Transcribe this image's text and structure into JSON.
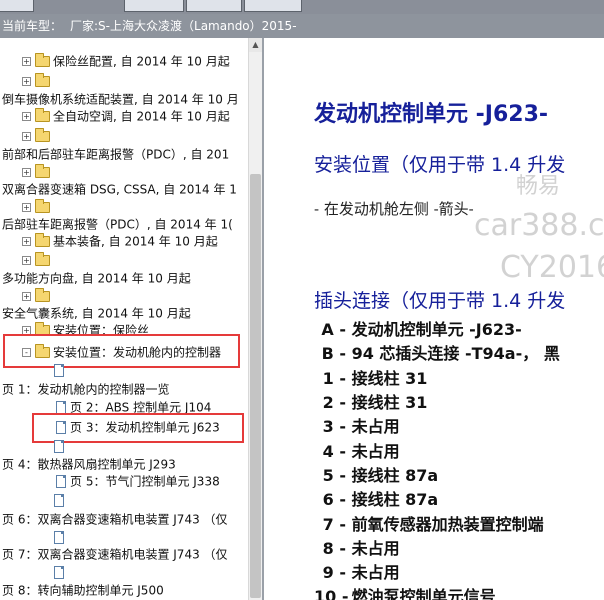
{
  "titlebar": {
    "label": "当前车型：",
    "model": "厂家:S-上海大众凌渡（Lamando）2015-"
  },
  "tree": [
    {
      "text": "保险丝配置, 自 2014 年 10 月起",
      "kind": "folder",
      "exp": "+"
    },
    {
      "text": "",
      "kind": "expander",
      "exp": "+"
    },
    {
      "text": "倒车摄像机系统适配装置, 自 2014 年 10 月",
      "kind": "text"
    },
    {
      "text": "全自动空调, 自 2014 年 10 月起",
      "kind": "folder",
      "exp": "+"
    },
    {
      "text": "",
      "kind": "expander",
      "exp": "+"
    },
    {
      "text": "前部和后部驻车距离报警（PDC）, 自 201",
      "kind": "text"
    },
    {
      "text": "",
      "kind": "expander",
      "exp": "+"
    },
    {
      "text": "双离合器变速箱 DSG, CSSA, 自 2014 年 1",
      "kind": "text"
    },
    {
      "text": "",
      "kind": "expander",
      "exp": "+"
    },
    {
      "text": "后部驻车距离报警（PDC）, 自 2014 年 1(",
      "kind": "text"
    },
    {
      "text": "基本装备, 自 2014 年 10 月起",
      "kind": "folder",
      "exp": "+"
    },
    {
      "text": "",
      "kind": "expander",
      "exp": "+"
    },
    {
      "text": "多功能方向盘, 自 2014 年 10 月起",
      "kind": "text"
    },
    {
      "text": "",
      "kind": "expander",
      "exp": "+"
    },
    {
      "text": "安全气囊系统, 自 2014 年 10 月起",
      "kind": "text"
    },
    {
      "text": "安装位置：保险丝",
      "kind": "folder",
      "exp": "+"
    },
    {
      "text": "安装位置：发动机舱内的控制器",
      "kind": "folder",
      "exp": "-"
    },
    {
      "text": "",
      "kind": "doc"
    },
    {
      "text": "页 1：发动机舱内的控制器一览",
      "kind": "text"
    },
    {
      "text": "页 2：ABS 控制单元 J104",
      "kind": "doc"
    },
    {
      "text": "页 3：发动机控制单元 J623",
      "kind": "doc"
    },
    {
      "text": "",
      "kind": "doc"
    },
    {
      "text": "页 4：散热器风扇控制单元 J293",
      "kind": "text"
    },
    {
      "text": "页 5：节气门控制单元 J338",
      "kind": "doc"
    },
    {
      "text": "",
      "kind": "doc"
    },
    {
      "text": "页 6：双离合器变速箱机电装置 J743 （仅",
      "kind": "text"
    },
    {
      "text": "",
      "kind": "doc"
    },
    {
      "text": "页 7：双离合器变速箱机电装置 J743 （仅",
      "kind": "text"
    },
    {
      "text": "",
      "kind": "doc"
    },
    {
      "text": "页 8：转向辅助控制单元 J500",
      "kind": "text"
    }
  ],
  "content": {
    "title": "发动机控制单元 -J623-",
    "section1": "安装位置（仅用于带 1.4 升发",
    "note": "- 在发动机舱左侧 -箭头-",
    "section2": "插头连接（仅用于带 1.4 升发",
    "pins": [
      {
        "key": "A -",
        "label": "发动机控制单元 -J623-"
      },
      {
        "key": "B -",
        "label": "94 芯插头连接 -T94a-， 黑"
      },
      {
        "key": "1 -",
        "label": "接线柱 31"
      },
      {
        "key": "2 -",
        "label": "接线柱 31"
      },
      {
        "key": "3 -",
        "label": "未占用"
      },
      {
        "key": "4 -",
        "label": "未占用"
      },
      {
        "key": "5 -",
        "label": "接线柱 87a"
      },
      {
        "key": "6 -",
        "label": "接线柱 87a"
      },
      {
        "key": "7 -",
        "label": "前氧传感器加热装置控制端"
      },
      {
        "key": "8 -",
        "label": "未占用"
      },
      {
        "key": "9 -",
        "label": "未占用"
      },
      {
        "key": "10 -",
        "label": "燃油泵控制单元信号"
      }
    ]
  },
  "watermark": {
    "line1": "畅易",
    "line2": "car388.co",
    "line3": "CY2016"
  }
}
